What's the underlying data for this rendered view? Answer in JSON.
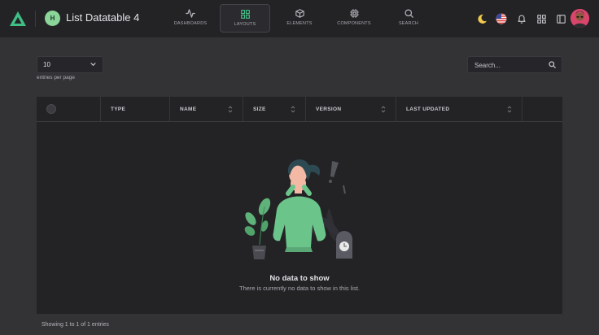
{
  "header": {
    "page_badge": "H",
    "page_title": "List Datatable 4",
    "nav": [
      {
        "label": "DASHBOARDS",
        "icon": "activity-icon",
        "active": false
      },
      {
        "label": "LAYOUTS",
        "icon": "grid-icon",
        "active": true
      },
      {
        "label": "ELEMENTS",
        "icon": "box-icon",
        "active": false
      },
      {
        "label": "COMPONENTS",
        "icon": "cpu-icon",
        "active": false
      },
      {
        "label": "SEARCH",
        "icon": "search-icon",
        "active": false
      }
    ],
    "icons": [
      "moon-icon",
      "us-flag-icon",
      "bell-icon",
      "apps-icon",
      "sidebar-toggle-icon",
      "user-avatar"
    ]
  },
  "controls": {
    "per_page_value": "10",
    "per_page_label": "entries per page",
    "search_placeholder": "Search..."
  },
  "table": {
    "columns": [
      "TYPE",
      "NAME",
      "SIZE",
      "VERSION",
      "LAST UPDATED"
    ],
    "empty_title": "No data to show",
    "empty_message": "There is currently no data to show in this list."
  },
  "footer": {
    "info": "Showing 1 to 1 of 1 entries"
  },
  "colors": {
    "accent": "#47c28a",
    "background": "#333336",
    "surface": "#232326"
  }
}
